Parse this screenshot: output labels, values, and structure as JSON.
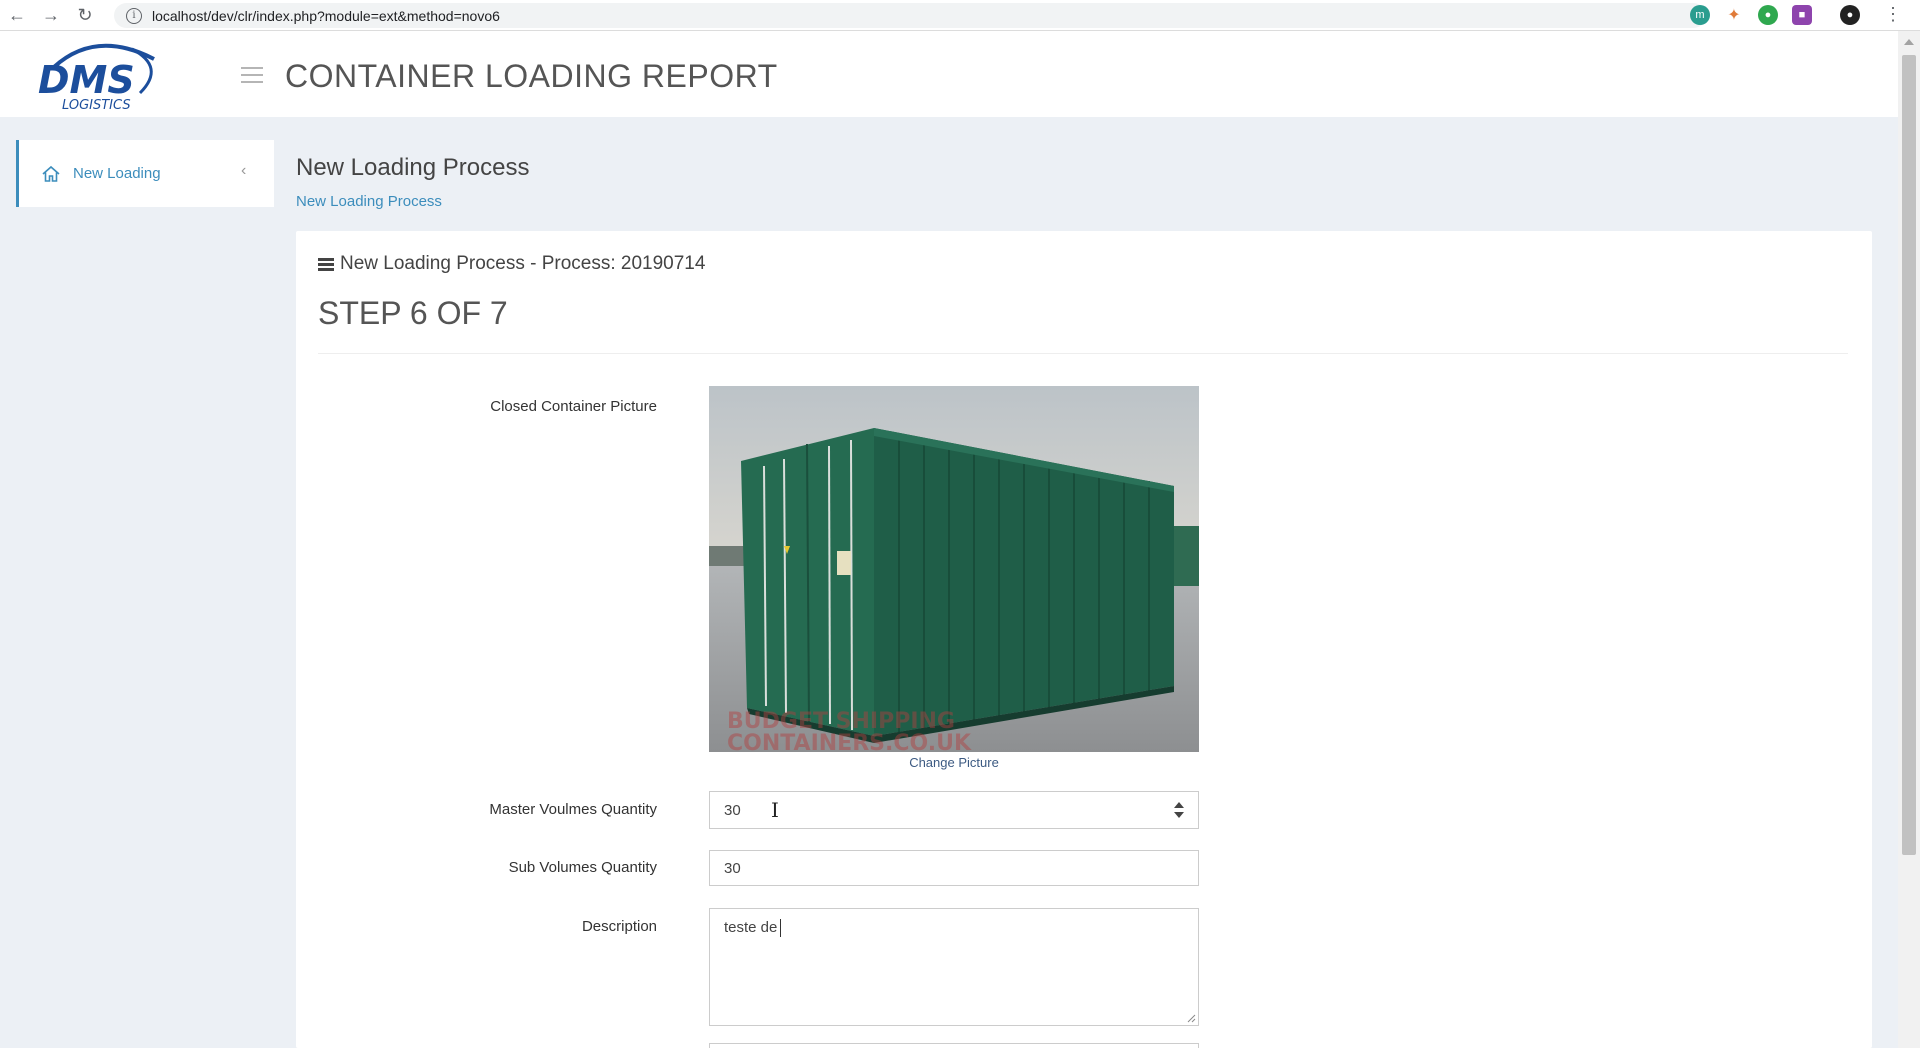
{
  "browser": {
    "url": "localhost/dev/clr/index.php?module=ext&method=novo6",
    "back_icon": "arrow-left-icon",
    "forward_icon": "arrow-right-icon",
    "reload_icon": "reload-icon",
    "bookmark_icon": "star-icon",
    "menu_icon": "kebab-menu-icon"
  },
  "header": {
    "logo_text": "DMS",
    "logo_subtext": "LOGISTICS",
    "title": "CONTAINER LOADING REPORT"
  },
  "sidebar": {
    "items": [
      {
        "label": "New Loading",
        "icon": "home-icon"
      }
    ]
  },
  "content": {
    "title": "New Loading Process",
    "breadcrumb": "New Loading Process"
  },
  "box": {
    "title": "New Loading Process - Process: 20190714",
    "step": "STEP 6 OF 7"
  },
  "form": {
    "picture_label": "Closed Container Picture",
    "change_picture": "Change Picture",
    "watermark_line1": "BUDGET SHIPPING",
    "watermark_line2": "CONTAINERS.CO.UK",
    "master_volumes_label": "Master Voulmes Quantity",
    "master_volumes_value": "30",
    "sub_volumes_label": "Sub Volumes Quantity",
    "sub_volumes_value": "30",
    "description_label": "Description",
    "description_value": "teste de"
  },
  "colors": {
    "accent": "#3c8dbc",
    "container_green": "#1f5e48",
    "background": "#ecf0f5"
  }
}
